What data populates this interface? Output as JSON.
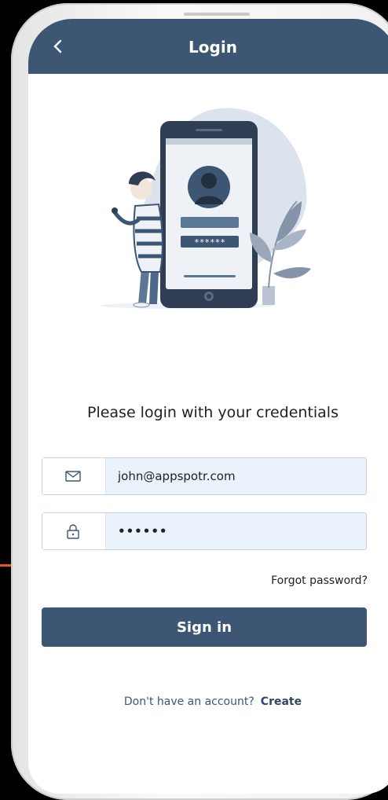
{
  "header": {
    "title": "Login",
    "back_icon": "chevron-left-icon"
  },
  "main": {
    "prompt": "Please login with your credentials"
  },
  "form": {
    "email": {
      "icon": "mail-icon",
      "value": "john@appspotr.com"
    },
    "password": {
      "icon": "lock-icon",
      "value": "••••••"
    },
    "forgot_label": "Forgot password?",
    "signin_label": "Sign in"
  },
  "illustration": {
    "password_mask": "******"
  },
  "footer": {
    "question": "Don't have an account?",
    "create_label": "Create"
  },
  "colors": {
    "primary": "#3d5674",
    "field_bg": "#eaf2fb",
    "accent_line": "#e8541e"
  }
}
